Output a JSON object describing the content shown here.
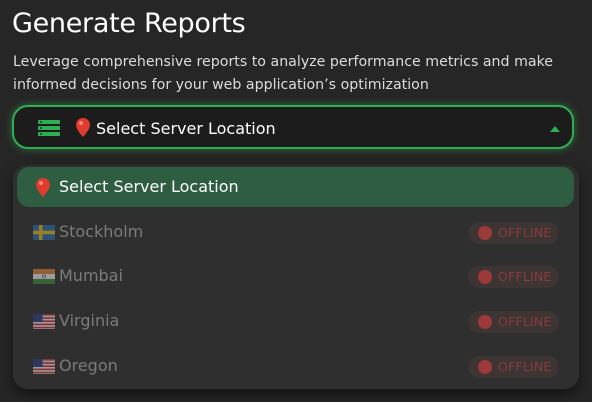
{
  "header": {
    "title": "Generate Reports",
    "description": "Leverage comprehensive reports to analyze performance metrics and make informed decisions for your web application’s optimization"
  },
  "location_select": {
    "icon": "server-icon",
    "pin_icon": "map-pin-icon",
    "selected_label": "Select Server Location",
    "accent_color": "#2fae52",
    "expanded": true
  },
  "dropdown": {
    "placeholder_option": {
      "icon": "map-pin-icon",
      "label": "Select Server Location"
    },
    "options": [
      {
        "flag_icon": "sweden-flag-icon",
        "label": "Stockholm",
        "status": "OFFLINE"
      },
      {
        "flag_icon": "india-flag-icon",
        "label": "Mumbai",
        "status": "OFFLINE"
      },
      {
        "flag_icon": "usa-flag-icon",
        "label": "Virginia",
        "status": "OFFLINE"
      },
      {
        "flag_icon": "usa-flag-icon",
        "label": "Oregon",
        "status": "OFFLINE"
      }
    ],
    "status_color": "#9c3a3a"
  }
}
